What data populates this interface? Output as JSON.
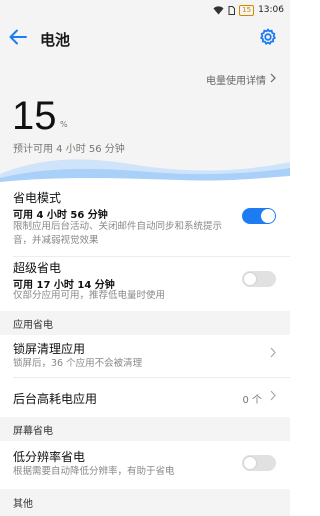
{
  "status_bar": {
    "battery_level": "15",
    "time": "13:06"
  },
  "header": {
    "title": "电池"
  },
  "battery": {
    "usage_details_link": "电量使用详情",
    "percent": "15",
    "percent_unit": "%",
    "estimate": "预计可用 4 小时 56 分钟"
  },
  "power_saving": {
    "title": "省电模式",
    "duration": "可用 4 小时 56 分钟",
    "description": "限制应用后台活动、关闭邮件自动同步和系统提示音，并减弱视觉效果",
    "enabled": true
  },
  "ultra_saving": {
    "title": "超级省电",
    "duration": "可用 17 小时 14 分钟",
    "description": "仅部分应用可用，推荐低电量时使用",
    "enabled": false
  },
  "section_apps": {
    "label": "应用省电"
  },
  "lockscreen_cleanup": {
    "title": "锁屏清理应用",
    "description": "锁屏后，36 个应用不会被清理"
  },
  "background_apps": {
    "title": "后台高耗电应用",
    "value": "0 个"
  },
  "section_screen": {
    "label": "屏幕省电"
  },
  "low_resolution": {
    "title": "低分辨率省电",
    "description": "根据需要自动降低分辨率，有助于省电",
    "enabled": false
  },
  "section_other": {
    "label": "其他"
  },
  "colors": {
    "accent": "#1d7cf2",
    "background": "#f4f4f4"
  }
}
